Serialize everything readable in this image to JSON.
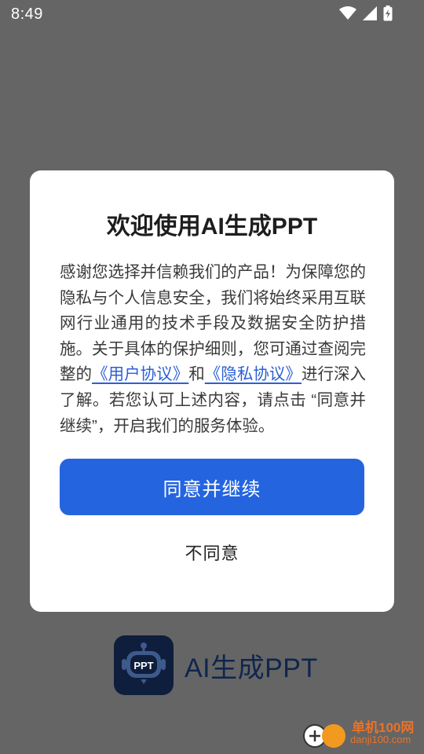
{
  "status_bar": {
    "time": "8:49",
    "icons": [
      "wifi-icon",
      "signal-icon",
      "battery-charging-icon"
    ]
  },
  "background_app": {
    "name": "AI生成PPT",
    "logo_text": "PPT",
    "colors": {
      "logo_bg": "#0f1e3c",
      "name": "#10254d"
    }
  },
  "dialog": {
    "title": "欢迎使用AI生成PPT",
    "body_part1": "感谢您选择并信赖我们的产品！为保障您的隐私与个人信息安全，我们将始终采用互联网行业通用的技术手段及数据安全防护措施。关于具体的保护细则，您可通过查阅完整的",
    "user_agreement_link": "《用户协议》",
    "body_and": "和",
    "privacy_link": "《隐私协议》",
    "body_part2": "进行深入了解。若您认可上述内容，请点击 “同意并继续”，开启我们的服务体验。",
    "agree_label": "同意并继续",
    "disagree_label": "不同意",
    "colors": {
      "primary": "#2464df",
      "link": "#2a5fd6"
    }
  },
  "watermark": {
    "name": "单机100网",
    "url": "danji100.com"
  }
}
